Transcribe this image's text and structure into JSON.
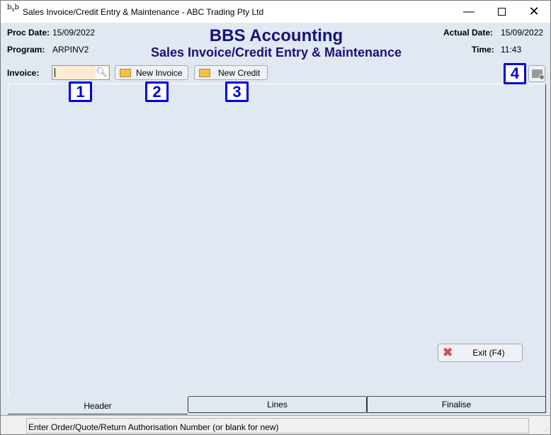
{
  "window": {
    "title": "Sales Invoice/Credit Entry & Maintenance - ABC Trading Pty Ltd",
    "app_icon": "bbs-logo-icon",
    "controls": [
      "minimize",
      "maximize",
      "close"
    ]
  },
  "header": {
    "proc_date_label": "Proc Date:",
    "proc_date": "15/09/2022",
    "program_label": "Program:",
    "program": "ARPINV2",
    "app_title": "BBS Accounting",
    "screen_title": "Sales Invoice/Credit Entry & Maintenance",
    "actual_date_label": "Actual Date:",
    "actual_date": "15/09/2022",
    "time_label": "Time:",
    "time": "11:43"
  },
  "toolbar": {
    "invoice_label": "Invoice:",
    "invoice_value": "",
    "new_invoice": "New Invoice",
    "new_credit": "New Credit"
  },
  "badges": [
    "1",
    "2",
    "3",
    "4"
  ],
  "exit_button": "Exit (F4)",
  "tabs": [
    {
      "label": "Header",
      "active": true
    },
    {
      "label": "Lines",
      "active": false
    },
    {
      "label": "Finalise",
      "active": false
    }
  ],
  "status": "Enter Order/Quote/Return Authorisation Number (or blank for new)",
  "colors": {
    "title_blue": "#141478",
    "badge_blue": "#0000e6",
    "background": "#e0e8f2",
    "input_bg": "#fdebd3"
  }
}
